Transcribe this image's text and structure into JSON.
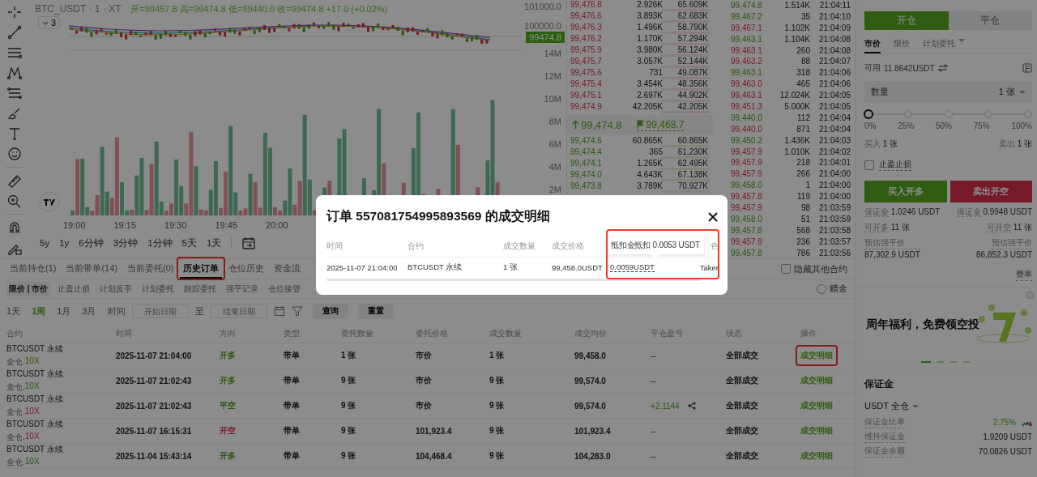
{
  "chart": {
    "symbol": "BTC_USDT · 1 · XT",
    "ohlc": "开=99457.8 高=99474.8 低=99440.0 收=99474.8 +17.0 (+0.02%)",
    "indicator_toggle": "3",
    "last_price": "99474.8",
    "price_ticks": [
      "101000.0",
      "100000.0"
    ],
    "volume_ticks": [
      "14M",
      "12M",
      "10M",
      "8M",
      "6M",
      "4M",
      "2M"
    ],
    "time_ticks": [
      "19:00",
      "19:15",
      "19:30",
      "19:45",
      "20:00"
    ],
    "intervals": [
      "5y",
      "1y",
      "6分钟",
      "3分钟",
      "1分钟",
      "5天",
      "1天"
    ]
  },
  "order_book": {
    "asks": [
      {
        "price": "99,476.8",
        "qty": "2.926K",
        "total": "65.609K",
        "level": 0.9
      },
      {
        "price": "99,476.6",
        "qty": "3.893K",
        "total": "62.683K",
        "level": 0.86
      },
      {
        "price": "99,476.3",
        "qty": "1.496K",
        "total": "58.790K",
        "level": 0.81
      },
      {
        "price": "99,476.2",
        "qty": "1.170K",
        "total": "57.294K",
        "level": 0.79
      },
      {
        "price": "99,475.9",
        "qty": "3.980K",
        "total": "56.124K",
        "level": 0.77
      },
      {
        "price": "99,475.7",
        "qty": "3.057K",
        "total": "52.144K",
        "level": 0.72
      },
      {
        "price": "99,475.6",
        "qty": "731",
        "total": "49.087K",
        "level": 0.67
      },
      {
        "price": "99,475.4",
        "qty": "3.454K",
        "total": "48.356K",
        "level": 0.66
      },
      {
        "price": "99,475.1",
        "qty": "2.697K",
        "total": "44.902K",
        "level": 0.62
      },
      {
        "price": "99,474.9",
        "qty": "42.205K",
        "total": "42.205K",
        "level": 0.58
      }
    ],
    "last": "99,474.8",
    "mark": "99,468.7",
    "bids": [
      {
        "price": "99,474.6",
        "qty": "60.865K",
        "total": "60.865K",
        "level": 0.83
      },
      {
        "price": "99,474.4",
        "qty": "365",
        "total": "61.230K",
        "level": 0.84
      },
      {
        "price": "99,474.1",
        "qty": "1.265K",
        "total": "62.495K",
        "level": 0.86
      },
      {
        "price": "99,474.0",
        "qty": "4.643K",
        "total": "67.138K",
        "level": 0.92
      },
      {
        "price": "99,473.8",
        "qty": "3.789K",
        "total": "70.927K",
        "level": 0.97
      }
    ]
  },
  "trades": [
    {
      "price": "99,474.8",
      "qty": "1.514K",
      "time": "21:04:11",
      "buy": true
    },
    {
      "price": "99,467.2",
      "qty": "35",
      "time": "21:04:10",
      "buy": true
    },
    {
      "price": "99,467.1",
      "qty": "1.102K",
      "time": "21:04:09",
      "buy": false
    },
    {
      "price": "99,463.1",
      "qty": "1.104K",
      "time": "21:04:08",
      "buy": true
    },
    {
      "price": "99,463.1",
      "qty": "260",
      "time": "21:04:08",
      "buy": false
    },
    {
      "price": "99,463.2",
      "qty": "88",
      "time": "21:04:07",
      "buy": false
    },
    {
      "price": "99,463.1",
      "qty": "318",
      "time": "21:04:06",
      "buy": true
    },
    {
      "price": "99,463.0",
      "qty": "465",
      "time": "21:04:06",
      "buy": false
    },
    {
      "price": "99,463.1",
      "qty": "12.024K",
      "time": "21:04:05",
      "buy": false
    },
    {
      "price": "99,451.3",
      "qty": "5.000K",
      "time": "21:04:05",
      "buy": false
    },
    {
      "price": "99,440.0",
      "qty": "112",
      "time": "21:04:04",
      "buy": true
    },
    {
      "price": "99,440.0",
      "qty": "871",
      "time": "21:04:04",
      "buy": false
    },
    {
      "price": "99,450.2",
      "qty": "1.436K",
      "time": "21:04:03",
      "buy": true
    },
    {
      "price": "99,457.9",
      "qty": "1.010K",
      "time": "21:04:02",
      "buy": false
    },
    {
      "price": "99,457.9",
      "qty": "218",
      "time": "21:04:01",
      "buy": false
    },
    {
      "price": "99,457.9",
      "qty": "266",
      "time": "21:04:00",
      "buy": false
    },
    {
      "price": "99,458.0",
      "qty": "1",
      "time": "21:04:00",
      "buy": true
    },
    {
      "price": "99,457.8",
      "qty": "119",
      "time": "21:04:00",
      "buy": false
    },
    {
      "price": "99,457.9",
      "qty": "98",
      "time": "21:03:59",
      "buy": false
    },
    {
      "price": "99,458.0",
      "qty": "51",
      "time": "21:03:59",
      "buy": true
    },
    {
      "price": "99,457.8",
      "qty": "568",
      "time": "21:03:58",
      "buy": true
    },
    {
      "price": "99,457.9",
      "qty": "236",
      "time": "21:03:57",
      "buy": false
    },
    {
      "price": "99,457.8",
      "qty": "786",
      "time": "21:03:56",
      "buy": true
    }
  ],
  "trade_form": {
    "modes": [
      {
        "label": "开仓",
        "selected": true
      },
      {
        "label": "平仓",
        "selected": false
      }
    ],
    "order_types": [
      {
        "label": "市价",
        "selected": true,
        "dropdown": false
      },
      {
        "label": "限价",
        "selected": false,
        "dropdown": false
      },
      {
        "label": "计划委托",
        "selected": false,
        "dropdown": true
      }
    ],
    "available_label": "可用",
    "available": "11.8642USDT",
    "quantity": {
      "label": "数量",
      "value": "1 张"
    },
    "slider": {
      "level": 0,
      "ticks": [
        "0%",
        "25%",
        "50%",
        "75%",
        "100%"
      ]
    },
    "buy_amount": {
      "label": "买入",
      "value": "1 张"
    },
    "sell_amount": {
      "label": "卖出",
      "value": "1 张"
    },
    "tp_sl": {
      "label": "止盈止损",
      "checked": false
    },
    "buy_button": "买入开多",
    "sell_button": "卖出开空",
    "stats": [
      {
        "kind": "inline",
        "left_label": "保证金",
        "left_value": "1.0246 USDT",
        "right_label": "保证金",
        "right_value": "0.9948 USDT"
      },
      {
        "kind": "inline",
        "left_label": "可开多",
        "left_value": "11 张",
        "right_label": "可开空",
        "right_value": "11 张"
      },
      {
        "kind": "stacked",
        "left_label": "预估强平价",
        "left_value": "87,302.9 USDT",
        "right_label": "预估强平价",
        "right_value": "86,852.3 USDT"
      }
    ],
    "fee_rate": "费率"
  },
  "banner": {
    "title": "周年福利，免费领空投",
    "slides": [
      {
        "selected": true
      },
      {
        "selected": false
      },
      {
        "selected": false
      },
      {
        "selected": false
      }
    ]
  },
  "margin": {
    "title": "保证金",
    "account": "USDT 全仓",
    "rows": [
      {
        "kind": "ratio",
        "label": "保证金比率",
        "value": "2.75%"
      },
      {
        "kind": "plain",
        "label": "维持保证金",
        "value": "1.9209 USDT"
      },
      {
        "kind": "plain",
        "label": "保证金余额",
        "value": "70.0826 USDT"
      }
    ]
  },
  "orders_panel": {
    "tabs": [
      {
        "label": "当前持仓(1)",
        "selected": false
      },
      {
        "label": "当前带单(14)",
        "selected": false
      },
      {
        "label": "当前委托(0)",
        "selected": false
      },
      {
        "label": "历史订单",
        "selected": true
      },
      {
        "label": "仓位历史",
        "selected": false
      },
      {
        "label": "资金流",
        "selected": false
      }
    ],
    "hide_others": {
      "label": "隐藏其他合约",
      "checked": false
    },
    "categories": [
      {
        "label": "限价 | 市价",
        "selected": true
      },
      {
        "label": "止盈止损",
        "selected": false
      },
      {
        "label": "计划反手",
        "selected": false
      },
      {
        "label": "计划委托",
        "selected": false
      },
      {
        "label": "跟踪委托",
        "selected": false
      },
      {
        "label": "强平记录",
        "selected": false
      },
      {
        "label": "仓位接管",
        "selected": false
      }
    ],
    "bonus": {
      "label": "赠金",
      "selected": false
    },
    "ranges": [
      {
        "label": "1天",
        "selected": false
      },
      {
        "label": "1周",
        "selected": true
      },
      {
        "label": "1月",
        "selected": false
      },
      {
        "label": "3月",
        "selected": false
      }
    ],
    "time_label": "时间",
    "start_placeholder": "开始日期",
    "to_label": "至",
    "end_placeholder": "结束日期",
    "query": "查询",
    "reset": "重置",
    "columns": [
      "合约",
      "时间",
      "方向",
      "类型",
      "委托数量",
      "委托价格",
      "成交数量",
      "成交均价",
      "平仓盈亏",
      "状态",
      "操作"
    ],
    "rows": [
      {
        "contract": "BTCUSDT 永续",
        "margin_mode": "全仓.",
        "leverage": "10X",
        "leverage_long": true,
        "time": "2025-11-07 21:04:00",
        "direction": "开多",
        "direction_long": true,
        "type": "带单",
        "order_qty": "1 张",
        "order_price": "市价",
        "filled_qty": "1 张",
        "avg_price": "99,458.0",
        "pnl": "--",
        "pnl_positive": false,
        "share": false,
        "status": "全部成交",
        "action": "成交明细"
      },
      {
        "contract": "BTCUSDT 永续",
        "margin_mode": "全仓.",
        "leverage": "10X",
        "leverage_long": true,
        "time": "2025-11-07 21:02:43",
        "direction": "开多",
        "direction_long": true,
        "type": "带单",
        "order_qty": "9 张",
        "order_price": "市价",
        "filled_qty": "9 张",
        "avg_price": "99,574.0",
        "pnl": "--",
        "pnl_positive": false,
        "share": false,
        "status": "全部成交",
        "action": "成交明细"
      },
      {
        "contract": "BTCUSDT 永续",
        "margin_mode": "全仓.",
        "leverage": "10X",
        "leverage_long": false,
        "time": "2025-11-07 21:02:43",
        "direction": "平空",
        "direction_long": true,
        "type": "带单",
        "order_qty": "9 张",
        "order_price": "市价",
        "filled_qty": "9 张",
        "avg_price": "99,574.0",
        "pnl": "+2.1144",
        "pnl_positive": true,
        "share": true,
        "status": "全部成交",
        "action": "成交明细"
      },
      {
        "contract": "BTCUSDT 永续",
        "margin_mode": "全仓.",
        "leverage": "10X",
        "leverage_long": false,
        "time": "2025-11-07 16:15:31",
        "direction": "开空",
        "direction_long": false,
        "type": "带单",
        "order_qty": "9 张",
        "order_price": "101,923.4",
        "filled_qty": "9 张",
        "avg_price": "101,923.4",
        "pnl": "--",
        "pnl_positive": false,
        "share": false,
        "status": "全部成交",
        "action": "成交明细"
      },
      {
        "contract": "BTCUSDT 永续",
        "margin_mode": "全仓.",
        "leverage": "10X",
        "leverage_long": true,
        "time": "2025-11-04 15:43:14",
        "direction": "开多",
        "direction_long": true,
        "type": "带单",
        "order_qty": "9 张",
        "order_price": "104,468.4",
        "filled_qty": "9 张",
        "avg_price": "104,283.0",
        "pnl": "--",
        "pnl_positive": false,
        "share": false,
        "status": "全部成交",
        "action": "成交明细"
      }
    ]
  },
  "trade_detail_modal": {
    "title": "订单 557081754995893569 的成交明细",
    "columns": [
      "时间",
      "合约",
      "成交数量",
      "成交价格",
      "色"
    ],
    "rows": [
      {
        "time": "2025-11-07 21:04:00",
        "contract": "BTCUSDT 永续",
        "qty": "1 张",
        "price": "99,458.0USDT",
        "fee": "0.0059USDT",
        "role": "Taker"
      }
    ],
    "tooltip": "抵扣金抵扣 0.0053 USDT"
  }
}
